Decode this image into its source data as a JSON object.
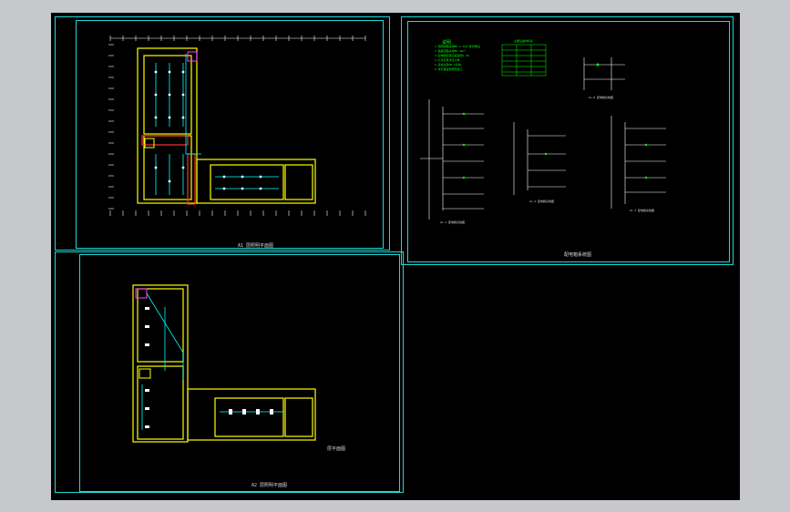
{
  "sheets": {
    "top_left": {
      "title": "A1 层照明平面图"
    },
    "bottom_left": {
      "title": "A2 层照明平面图",
      "side_label": "层平面图"
    },
    "right": {
      "title": "配电箱系统图"
    }
  },
  "colors": {
    "background": "#000000",
    "viewport": "#c6c8cc",
    "frame": "#20d8d8",
    "dimension": "#ffffff",
    "wall": "#ffff00",
    "grid": "#00ff00",
    "wire": "#00ffff",
    "accent": "#ff3030",
    "magenta": "#ff40ff"
  },
  "legend": {
    "notes_title": "说明",
    "notes": [
      "1.照明线路采用BV-2.5mm²穿管敷设",
      "2.插座回路采用BV-4mm²",
      "3.配电箱安装高度距地1.5m",
      "4.灯具安装详见大样",
      "5.接地采用TN-S系统",
      "6.未尽事宜按规范施工"
    ],
    "table_title": "主要设备材料表"
  },
  "diagrams": [
    {
      "label": "AL-1 配电箱系统图"
    },
    {
      "label": "AL-2 配电箱系统图"
    },
    {
      "label": "AL-3 配电箱系统图"
    },
    {
      "label": "AL-0 配电箱系统图"
    }
  ]
}
